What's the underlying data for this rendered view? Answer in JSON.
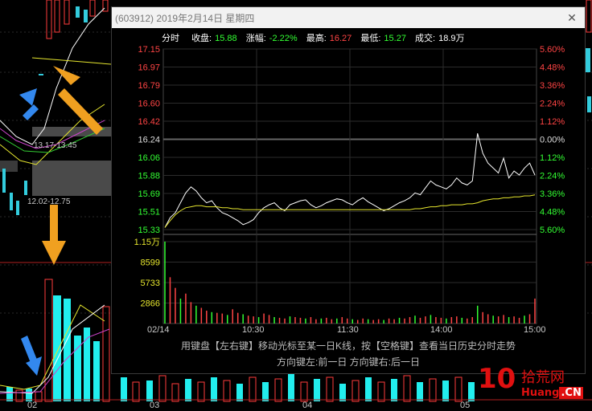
{
  "background": {
    "range_labels": [
      "13.17-13.45",
      "12.02-12.75"
    ],
    "date_labels": [
      "02",
      "03",
      "04",
      "05"
    ]
  },
  "popup": {
    "title": "(603912) 2019年2月14日 星期四",
    "close_symbol": "✕",
    "info": {
      "mode": "分时",
      "close_label": "收盘:",
      "close_value": "15.88",
      "change_label": "涨幅:",
      "change_value": "-2.22%",
      "high_label": "最高:",
      "high_value": "16.27",
      "low_label": "最低:",
      "low_value": "15.27",
      "volume_label": "成交:",
      "volume_value": "18.9万"
    },
    "help_line1": "用键盘【左右键】移动光标至某一日K线，按【空格键】查看当日历史分时走势",
    "help_line2": "方向键左:前一日    方向键右:后一日"
  },
  "chart_data": {
    "type": "line",
    "title": "",
    "ylim": [
      15.33,
      17.15
    ],
    "prev_close": 16.24,
    "price_ticks": [
      "17.15",
      "16.97",
      "16.79",
      "16.60",
      "16.42",
      "16.24",
      "16.06",
      "15.88",
      "15.69",
      "15.51",
      "15.33"
    ],
    "pct_ticks": [
      "5.60%",
      "4.48%",
      "3.36%",
      "2.24%",
      "1.12%",
      "0.00%",
      "1.12%",
      "2.24%",
      "3.36%",
      "4.48%",
      "5.60%"
    ],
    "volume_ticks": [
      "1.15万",
      "8599",
      "5733",
      "2866"
    ],
    "x_ticks": [
      "02/14",
      "10:30",
      "11:30",
      "14:00",
      "15:00"
    ],
    "series": [
      {
        "values": [
          15.35,
          15.45,
          15.5,
          15.6,
          15.7,
          15.76,
          15.72,
          15.65,
          15.6,
          15.62,
          15.55,
          15.5,
          15.48,
          15.45,
          15.42,
          15.38,
          15.4,
          15.43,
          15.5,
          15.55,
          15.58,
          15.6,
          15.55,
          15.52,
          15.58,
          15.6,
          15.62,
          15.63,
          15.58,
          15.55,
          15.57,
          15.6,
          15.62,
          15.64,
          15.63,
          15.6,
          15.58,
          15.62,
          15.65,
          15.61,
          15.58,
          15.55,
          15.52,
          15.54,
          15.57,
          15.6,
          15.62,
          15.65,
          15.7,
          15.68,
          15.75,
          15.82,
          15.78,
          15.76,
          15.74,
          15.78,
          15.85,
          15.8,
          15.78,
          15.82,
          16.3,
          16.1,
          16.0,
          15.95,
          15.9,
          16.05,
          15.85,
          15.92,
          15.88,
          15.95,
          16.0,
          15.88
        ],
        "color": "#ffffff"
      },
      {
        "values": [
          15.35,
          15.42,
          15.48,
          15.52,
          15.55,
          15.56,
          15.57,
          15.57,
          15.56,
          15.56,
          15.56,
          15.55,
          15.55,
          15.54,
          15.54,
          15.53,
          15.53,
          15.53,
          15.53,
          15.53,
          15.53,
          15.53,
          15.53,
          15.53,
          15.53,
          15.53,
          15.53,
          15.53,
          15.53,
          15.53,
          15.53,
          15.53,
          15.53,
          15.53,
          15.53,
          15.53,
          15.53,
          15.53,
          15.53,
          15.53,
          15.53,
          15.53,
          15.53,
          15.53,
          15.53,
          15.53,
          15.53,
          15.53,
          15.54,
          15.54,
          15.55,
          15.56,
          15.56,
          15.57,
          15.57,
          15.58,
          15.58,
          15.58,
          15.59,
          15.59,
          15.6,
          15.62,
          15.63,
          15.64,
          15.64,
          15.65,
          15.65,
          15.66,
          15.66,
          15.67,
          15.67,
          15.68
        ],
        "color": "#e6e62e"
      }
    ],
    "volume": [
      11500,
      6500,
      5000,
      3500,
      4200,
      3000,
      2500,
      2200,
      1800,
      1600,
      1500,
      1400,
      1200,
      2000,
      1500,
      1300,
      1100,
      1000,
      900,
      1400,
      1200,
      900,
      800,
      700,
      1000,
      900,
      800,
      700,
      900,
      600,
      700,
      800,
      600,
      700,
      900,
      700,
      600,
      500,
      700,
      600,
      500,
      600,
      500,
      700,
      600,
      800,
      700,
      900,
      1100,
      800,
      1000,
      1200,
      900,
      800,
      700,
      900,
      1000,
      800,
      700,
      900,
      2500,
      1600,
      1300,
      1100,
      1000,
      1200,
      900,
      1000,
      800,
      1100,
      1300,
      3500
    ],
    "volume_ylim": [
      0,
      11500
    ],
    "grid": true
  },
  "watermark": {
    "number": "10",
    "brand": "拾荒网",
    "domain_left": "Huang",
    "domain_right": ".CN"
  }
}
